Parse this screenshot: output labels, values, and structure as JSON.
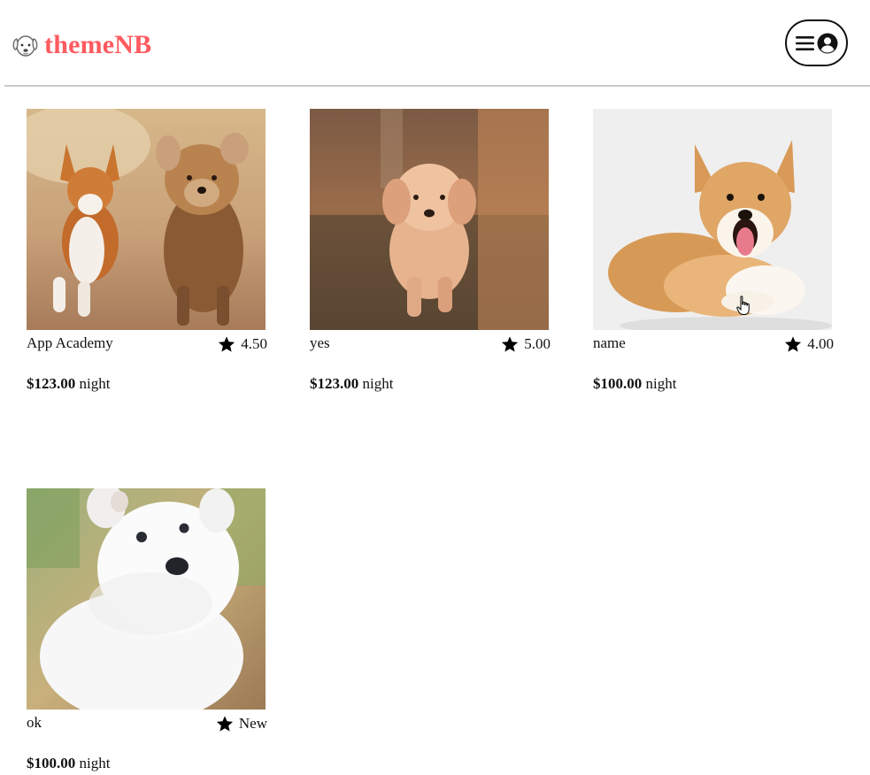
{
  "header": {
    "logo_text": "themeNB",
    "logo_icon": "dog-face-icon",
    "menu_icon": "hamburger-icon",
    "profile_icon": "user-circle-icon"
  },
  "colors": {
    "brand": "#ff5a5f",
    "divider": "#c9c9c9"
  },
  "listings": [
    {
      "name": "App Academy",
      "rating": "4.50",
      "price": "$123.00",
      "unit": "night",
      "image": "two-dogs-running-photo"
    },
    {
      "name": "yes",
      "rating": "5.00",
      "price": "$123.00",
      "unit": "night",
      "image": "golden-puppy-running-photo"
    },
    {
      "name": "name",
      "rating": "4.00",
      "price": "$100.00",
      "unit": "night",
      "image": "corgi-lying-photo"
    },
    {
      "name": "ok",
      "rating": "New",
      "price": "$100.00",
      "unit": "night",
      "image": "white-puppy-photo"
    }
  ]
}
